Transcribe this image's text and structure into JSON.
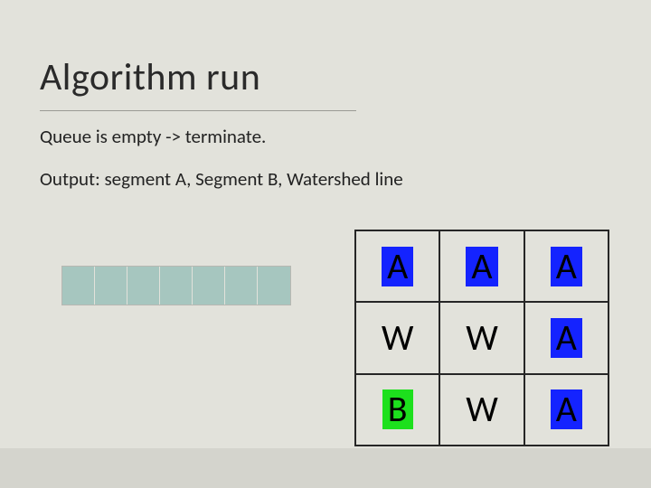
{
  "title": "Algorithm run",
  "line1": "Queue is empty -> terminate.",
  "line2": "Output: segment A, Segment B, Watershed line",
  "queue": {
    "cells": 7
  },
  "grid": {
    "cells": [
      {
        "label": "A",
        "chip": "blue"
      },
      {
        "label": "A",
        "chip": "blue"
      },
      {
        "label": "A",
        "chip": "blue"
      },
      {
        "label": "W",
        "chip": "none"
      },
      {
        "label": "W",
        "chip": "none"
      },
      {
        "label": "A",
        "chip": "blue"
      },
      {
        "label": "B",
        "chip": "green"
      },
      {
        "label": "W",
        "chip": "none"
      },
      {
        "label": "A",
        "chip": "blue"
      }
    ]
  }
}
